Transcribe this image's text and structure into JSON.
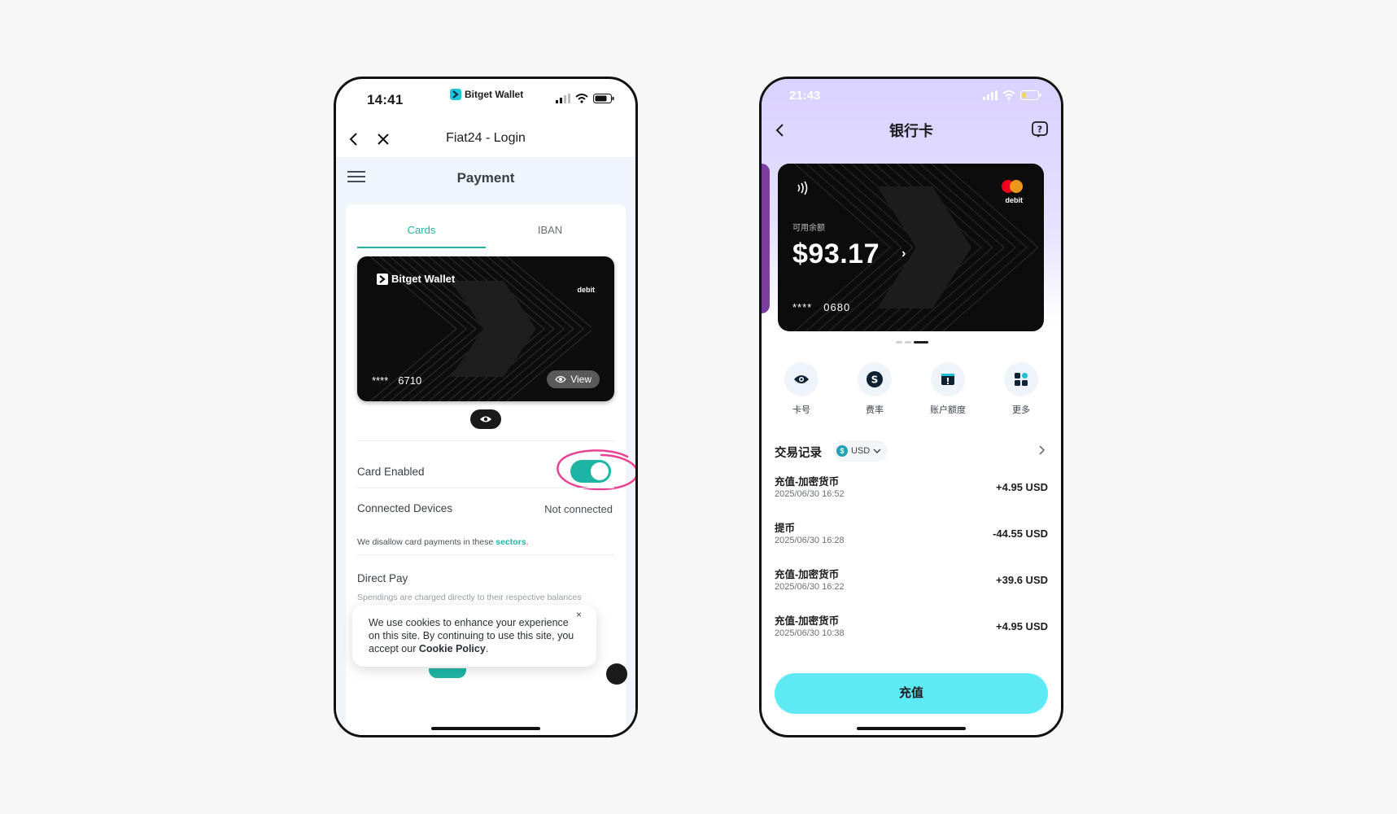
{
  "left": {
    "status": {
      "time": "14:41",
      "app_name": "Bitget Wallet"
    },
    "nav": {
      "title": "Fiat24 - Login"
    },
    "page": {
      "title": "Payment"
    },
    "tabs": [
      {
        "label": "Cards"
      },
      {
        "label": "IBAN"
      }
    ],
    "card": {
      "brand": "Bitget Wallet",
      "type": "debit",
      "masked": "****",
      "last4": "6710",
      "view_label": "View"
    },
    "card_enabled": {
      "label": "Card Enabled",
      "on": true
    },
    "connected_devices": {
      "label": "Connected Devices",
      "value": "Not connected"
    },
    "sectors_note": {
      "prefix": "We disallow card payments in these ",
      "link": "sectors",
      "suffix": "."
    },
    "direct_pay": {
      "label": "Direct Pay",
      "description": "Spendings are charged directly to their respective balances"
    },
    "cookie": {
      "text_1": "We use cookies to enhance your experience on this site. By continuing to use this site, you accept our ",
      "link": "Cookie Policy",
      "text_2": ".",
      "close": "×"
    },
    "colors": {
      "accent": "#1fb5a6",
      "annotation": "#e84393"
    }
  },
  "right": {
    "status": {
      "time": "21:43"
    },
    "title": "银行卡",
    "card": {
      "available_label": "可用余额",
      "balance": "$93.17",
      "masked": "****",
      "last4": "0680",
      "type": "debit"
    },
    "actions": [
      {
        "label": "卡号",
        "icon": "eye-icon"
      },
      {
        "label": "费率",
        "icon": "dollar-icon"
      },
      {
        "label": "账户额度",
        "icon": "limit-icon"
      },
      {
        "label": "更多",
        "icon": "grid-icon"
      }
    ],
    "transactions": {
      "title": "交易记录",
      "currency": "USD",
      "items": [
        {
          "name": "充值-加密货币",
          "date": "2025/06/30 16:52",
          "amount": "+4.95 USD"
        },
        {
          "name": "提币",
          "date": "2025/06/30 16:28",
          "amount": "-44.55 USD"
        },
        {
          "name": "充值-加密货币",
          "date": "2025/06/30 16:22",
          "amount": "+39.6 USD"
        },
        {
          "name": "充值-加密货币",
          "date": "2025/06/30 10:38",
          "amount": "+4.95 USD"
        }
      ]
    },
    "topup_label": "充值",
    "colors": {
      "topup": "#5eeaf5",
      "gradient_top": "#d9d1ff"
    }
  }
}
